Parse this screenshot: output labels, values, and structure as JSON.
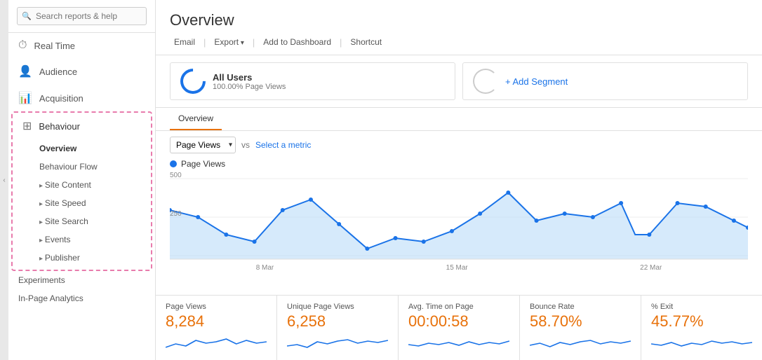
{
  "sidebar": {
    "search_placeholder": "Search reports & help",
    "nav_items": [
      {
        "id": "realtime",
        "label": "Real Time",
        "icon": "⏱"
      },
      {
        "id": "audience",
        "label": "Audience",
        "icon": "👥"
      },
      {
        "id": "acquisition",
        "label": "Acquisition",
        "icon": "📈"
      }
    ],
    "behaviour_section": {
      "label": "Behaviour",
      "sub_items": [
        {
          "label": "Overview",
          "bold": true
        },
        {
          "label": "Behaviour Flow",
          "arrow": false
        },
        {
          "label": "Site Content",
          "arrow": true
        },
        {
          "label": "Site Speed",
          "arrow": true
        },
        {
          "label": "Site Search",
          "arrow": true
        },
        {
          "label": "Events",
          "arrow": true
        },
        {
          "label": "Publisher",
          "arrow": true
        }
      ]
    },
    "bottom_items": [
      {
        "label": "Experiments"
      },
      {
        "label": "In-Page Analytics"
      }
    ]
  },
  "header": {
    "title": "Overview",
    "toolbar": {
      "email": "Email",
      "export": "Export",
      "add_to_dashboard": "Add to Dashboard",
      "shortcut": "Shortcut"
    }
  },
  "segment": {
    "name": "All Users",
    "sub": "100.00% Page Views",
    "add_label": "+ Add Segment"
  },
  "tabs": [
    {
      "label": "Overview",
      "active": true
    }
  ],
  "chart_controls": {
    "metric": "Page Views",
    "vs_label": "vs",
    "select_metric": "Select a metric"
  },
  "chart": {
    "legend_label": "Page Views",
    "y_max": "500",
    "y_mid": "250",
    "x_labels": [
      "8 Mar",
      "15 Mar",
      "22 Mar"
    ]
  },
  "stats": [
    {
      "label": "Page Views",
      "value": "8,284"
    },
    {
      "label": "Unique Page Views",
      "value": "6,258"
    },
    {
      "label": "Avg. Time on Page",
      "value": "00:00:58"
    },
    {
      "label": "Bounce Rate",
      "value": "58.70%"
    },
    {
      "label": "% Exit",
      "value": "45.77%"
    }
  ]
}
